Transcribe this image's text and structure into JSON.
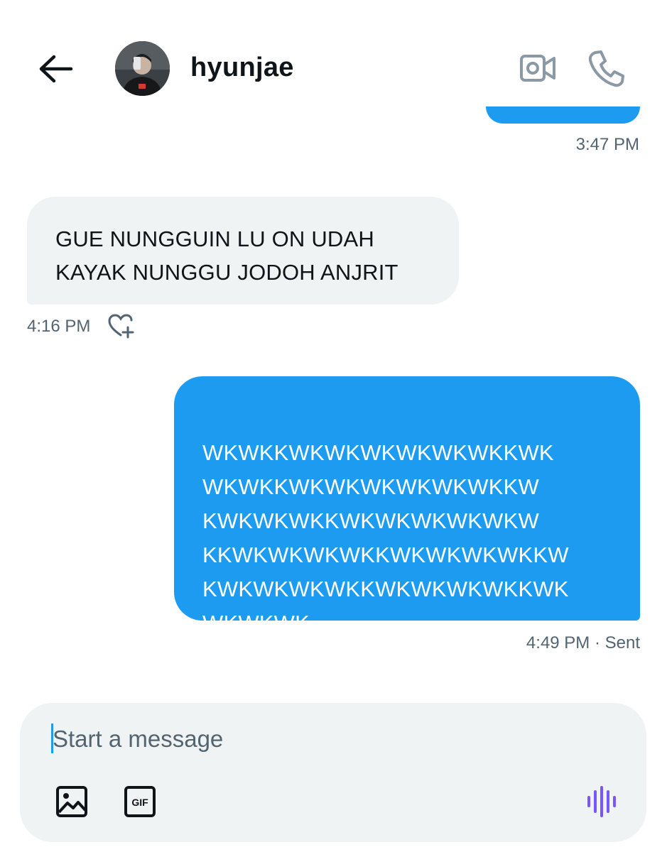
{
  "header": {
    "contact_name": "hyunjae",
    "icons": {
      "back": "arrow-left-icon",
      "video": "video-camera-icon",
      "call": "phone-icon"
    }
  },
  "messages": [
    {
      "direction": "outgoing",
      "partial": true,
      "timestamp": "3:47 PM"
    },
    {
      "direction": "incoming",
      "text": "GUE NUNGGUIN LU ON UDAH\nKAYAK NUNGGU JODOH ANJRIT",
      "timestamp": "4:16 PM",
      "reaction_icon": "heart-plus-icon"
    },
    {
      "direction": "outgoing",
      "text": "WKWKKWKWKWKWKWKWKKWK\nWKWKKWKWKWKWKWKWKKW\nKWKWKWKKWKWKWKWKWKW\nKKWKWKWKWKKWKWKWKWKKW\nKWKWKWKWKKWKWKWKWKKWK\nWKWKWK",
      "timestamp": "4:49 PM · Sent"
    }
  ],
  "composer": {
    "placeholder": "Start a message",
    "value": "",
    "buttons": {
      "image": "image-icon",
      "gif": "GIF",
      "voice": "voice-waveform-icon"
    }
  },
  "colors": {
    "accent": "#1d9bf0",
    "incoming_bubble": "#eff3f4",
    "secondary_text": "#536471",
    "voice_icon": "#7856ff"
  }
}
